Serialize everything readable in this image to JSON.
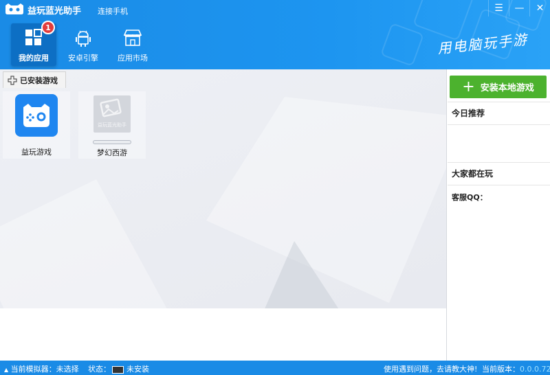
{
  "window": {
    "title": "益玩蓝光助手",
    "connect_label": "连接手机",
    "slogan": "用电脑玩手游",
    "controls": {
      "menu": "☰",
      "minimize": "—",
      "close": "✕"
    }
  },
  "nav": {
    "items": [
      {
        "label": "我的应用",
        "icon": "grid-icon",
        "active": true,
        "badge": "1"
      },
      {
        "label": "安卓引擎",
        "icon": "android-icon",
        "active": false
      },
      {
        "label": "应用市场",
        "icon": "store-icon",
        "active": false
      }
    ]
  },
  "main": {
    "tab_label": "已安装游戏",
    "games": [
      {
        "name": "益玩游戏",
        "icon": "gamepad-app-icon"
      },
      {
        "name": "梦幻西游",
        "icon": "placeholder-image-icon",
        "placeholder_text": "益玩蓝光助手",
        "progress": 0
      }
    ]
  },
  "side": {
    "install_label": "安装本地游戏",
    "today_label": "今日推荐",
    "popular_label": "大家都在玩",
    "qq_label": "客服QQ："
  },
  "status": {
    "emulator_label": "当前模拟器：未选择",
    "state_label": "状态：",
    "state_value": "未安装",
    "help_text": "使用遇到问题，去请教大神!",
    "version_label": "当前版本：",
    "version_value": "0.0.0.72"
  },
  "colors": {
    "header": "#1a8be6",
    "active_nav": "#0d6fc4",
    "install_green": "#4cb22e",
    "badge_red": "#e23c3c"
  }
}
